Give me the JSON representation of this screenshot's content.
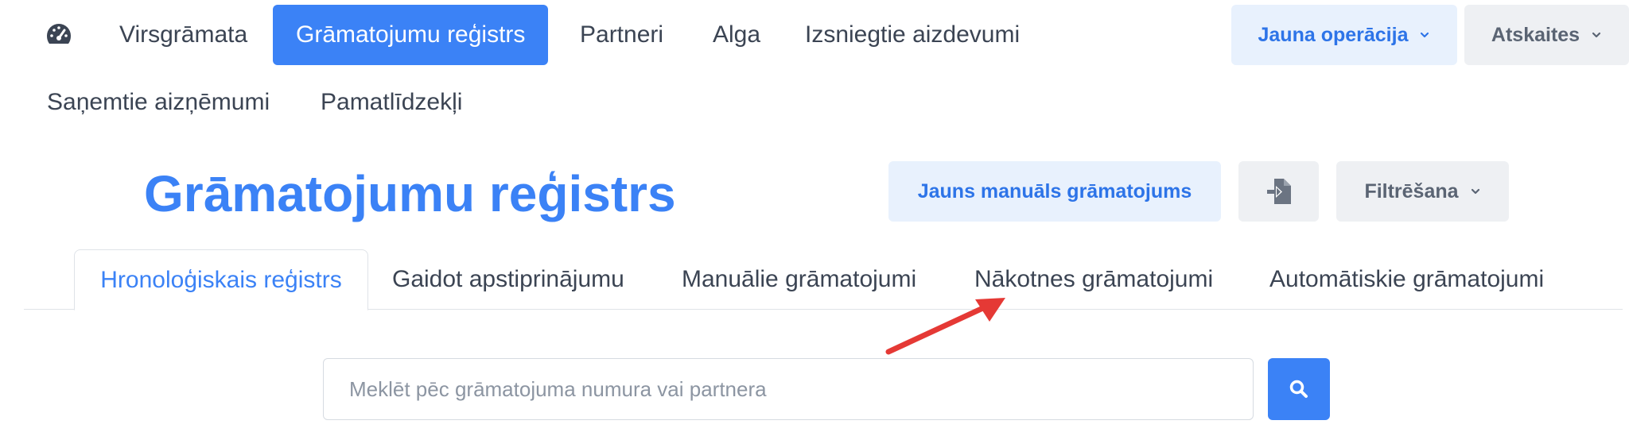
{
  "nav": {
    "items": [
      {
        "label": "Virsgrāmata"
      },
      {
        "label": "Grāmatojumu reģistrs",
        "active": true
      },
      {
        "label": "Partneri"
      },
      {
        "label": "Alga"
      },
      {
        "label": "Izsniegtie aizdevumi"
      },
      {
        "label": "Saņemtie aizņēmumi"
      },
      {
        "label": "Pamatlīdzekļi"
      }
    ],
    "new_operation_label": "Jauna operācija",
    "reports_label": "Atskaites"
  },
  "page": {
    "title": "Grāmatojumu reģistrs",
    "new_manual_entry_label": "Jauns manuāls grāmatojums",
    "filter_label": "Filtrēšana"
  },
  "tabs": [
    {
      "label": "Hronoloģiskais reģistrs",
      "active": true
    },
    {
      "label": "Gaidot apstiprinājumu"
    },
    {
      "label": "Manuālie grāmatojumi"
    },
    {
      "label": "Nākotnes grāmatojumi"
    },
    {
      "label": "Automātiskie grāmatojumi"
    }
  ],
  "search": {
    "placeholder": "Meklēt pēc grāmatojuma numura vai partnera",
    "value": ""
  },
  "colors": {
    "accent": "#3b82f6",
    "annotation_arrow": "#e53935"
  },
  "icons": {
    "dashboard": "speedometer-icon",
    "import": "file-import-icon",
    "search": "search-icon",
    "chevron": "chevron-down-icon"
  }
}
